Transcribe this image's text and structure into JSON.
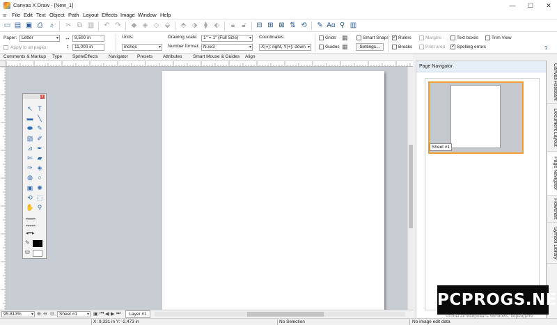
{
  "window": {
    "title": "Canvas X Draw - [New_1]",
    "minimize": "—",
    "maximize": "☐",
    "close": "✕"
  },
  "menu": [
    "File",
    "Edit",
    "Text",
    "Object",
    "Path",
    "Layout",
    "Effects",
    "Image",
    "Window",
    "Help"
  ],
  "props": {
    "paper_label": "Paper:",
    "paper_value": "Letter",
    "width_value": "8,500 in",
    "height_value": "11,000 in",
    "apply_all_pages": "Apply to all pages",
    "units_label": "Units:",
    "units_value": "inches",
    "drawing_scale_label": "Drawing scale:",
    "drawing_scale_value": "1\" = 1\" (Full Size)",
    "number_format_label": "Number format:",
    "number_format_value": "N.xx3",
    "coordinates_label": "Coordinates:",
    "coordinates_value": "X(+): right, Y(+): down",
    "grids": "Grids",
    "guides": "Guides",
    "smart_snaps": "Smart Snaps",
    "settings_button": "Settings...",
    "rulers": "Rulers",
    "breaks": "Breaks",
    "margins": "Margins",
    "print_area": "Print area",
    "text_boxes": "Text boxes",
    "spelling_errors": "Spelling errors",
    "trim_view": "Trim View",
    "help": "?"
  },
  "tabs": [
    "Comments & Markup",
    "Type",
    "SpriteEffects",
    "Navigator",
    "Presets",
    "Attributes",
    "Smart Mouse & Guides",
    "Align"
  ],
  "toolbox": {
    "close": "x",
    "tools": [
      {
        "name": "select-arrow-icon",
        "glyph": "↖"
      },
      {
        "name": "text-tool-icon",
        "glyph": "T"
      },
      {
        "name": "rectangle-tool-icon",
        "glyph": "▬"
      },
      {
        "name": "line-tool-icon",
        "glyph": "╲"
      },
      {
        "name": "oval-tool-icon",
        "glyph": "⬬"
      },
      {
        "name": "freehand-tool-icon",
        "glyph": "✎"
      },
      {
        "name": "image-tool-icon",
        "glyph": "▧"
      },
      {
        "name": "paint-tool-icon",
        "glyph": "✐"
      },
      {
        "name": "eyedropper-tool-icon",
        "glyph": "⊿"
      },
      {
        "name": "brush-tool-icon",
        "glyph": "✒"
      },
      {
        "name": "knife-tool-icon",
        "glyph": "✄"
      },
      {
        "name": "eraser-tool-icon",
        "glyph": "▰"
      },
      {
        "name": "pen-tool-icon",
        "glyph": "✑"
      },
      {
        "name": "fill-tool-icon",
        "glyph": "◈"
      },
      {
        "name": "blend-tool-icon",
        "glyph": "◍"
      },
      {
        "name": "node-tool-icon",
        "glyph": "○"
      },
      {
        "name": "stamp-tool-icon",
        "glyph": "▣"
      },
      {
        "name": "sprite-tool-icon",
        "glyph": "✺"
      },
      {
        "name": "rotate-tool-icon",
        "glyph": "⟲"
      },
      {
        "name": "crop-tool-icon",
        "glyph": "⬚"
      },
      {
        "name": "hand-tool-icon",
        "glyph": "✋"
      },
      {
        "name": "zoom-tool-icon",
        "glyph": "⚲"
      }
    ],
    "line_solid": "━━━━",
    "line_dashed": "╍╍╍╍",
    "arrow_style": "◂━━▸"
  },
  "navigator": {
    "title": "Page Navigator",
    "sheet_label": "Sheet #1"
  },
  "side_tabs": [
    "Canvas Assistant",
    "Document Layout",
    "Page Navigator",
    "Flowchart",
    "Symbol Library"
  ],
  "bottom": {
    "zoom": "95.813%",
    "sheet": "Sheet #1",
    "layer": "Layer #1"
  },
  "status": {
    "coords": "X: 9,331 in   Y: -2,473 in",
    "selection": "No Selection",
    "image_edit": "No image edit data"
  },
  "watermark": "PCPROGS.NET",
  "activate_windows": "Чтобы активировать Windows, перейдите"
}
